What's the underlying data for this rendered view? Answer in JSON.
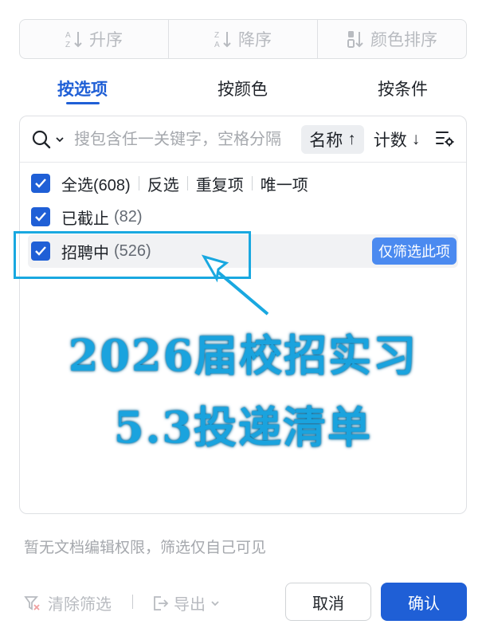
{
  "sort_bar": {
    "ascending": "升序",
    "descending": "降序",
    "by_color": "颜色排序"
  },
  "tabs": [
    {
      "label": "按选项",
      "active": true
    },
    {
      "label": "按颜色",
      "active": false
    },
    {
      "label": "按条件",
      "active": false
    }
  ],
  "search": {
    "placeholder": "搜包含任一关键字，空格分隔",
    "value": ""
  },
  "sort_options": {
    "name": "名称",
    "name_arrow": "↑",
    "count": "计数",
    "count_arrow": "↓"
  },
  "select_row": {
    "label": "全选",
    "count": "(608)",
    "checked": true,
    "actions": [
      "反选",
      "重复项",
      "唯一项"
    ]
  },
  "items": [
    {
      "label": "已截止",
      "count": "(82)",
      "checked": true
    },
    {
      "label": "招聘中",
      "count": "(526)",
      "checked": true,
      "action": "仅筛选此项"
    }
  ],
  "overlay": {
    "line1": "2026届校招实习",
    "line2": "5.3投递清单"
  },
  "notice": "暂无文档编辑权限，筛选仅自己可见",
  "footer": {
    "clear": "清除筛选",
    "export": "导出",
    "cancel": "取消",
    "confirm": "确认"
  },
  "colors": {
    "accent": "#1f5fd6",
    "annotation": "#19a8e0"
  }
}
